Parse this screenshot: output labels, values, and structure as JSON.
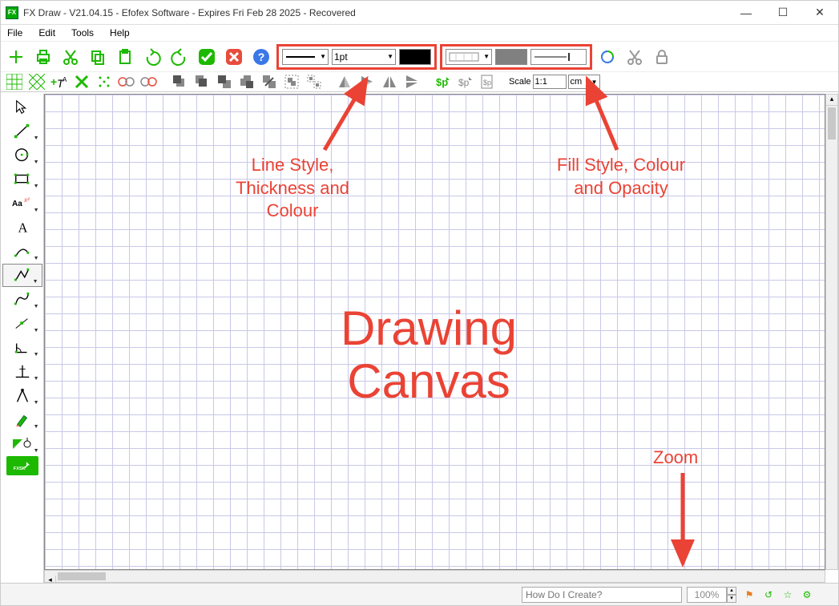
{
  "window": {
    "title": "FX Draw - V21.04.15 - Efofex Software - Expires Fri Feb 28 2025 - Recovered"
  },
  "menu": {
    "file": "File",
    "edit": "Edit",
    "tools": "Tools",
    "help": "Help"
  },
  "toolbar": {
    "line_thickness": "1pt",
    "line_color": "#000000",
    "fill_color": "#808080",
    "scale_label": "Scale",
    "scale_value": "1:1",
    "unit": "cm"
  },
  "annotations": {
    "line": "Line Style,\nThickness and\nColour",
    "fill": "Fill Style, Colour\nand Opacity",
    "canvas": "Drawing\nCanvas",
    "zoom": "Zoom"
  },
  "status": {
    "help_placeholder": "How Do I Create?",
    "zoom": "100%"
  },
  "left_tools": [
    "select",
    "line",
    "circle",
    "rect",
    "text-eq",
    "text",
    "curve",
    "polyline",
    "pen",
    "point",
    "angle",
    "perp",
    "compass",
    "marker",
    "ruler",
    "fxsk"
  ]
}
